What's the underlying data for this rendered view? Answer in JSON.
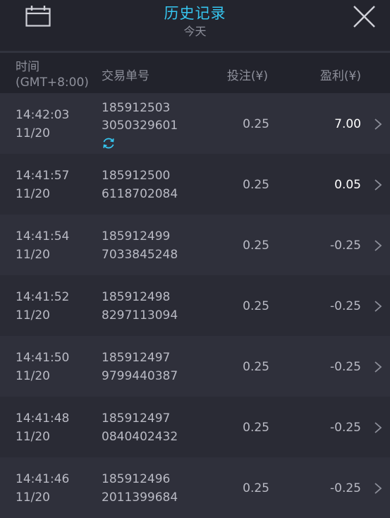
{
  "header": {
    "title": "历史记录",
    "subtitle": "今天",
    "accent_color": "#36c6f0",
    "left_icon": "calendar-icon",
    "right_icon": "close-icon"
  },
  "columns": {
    "time_line1": "时间",
    "time_line2": "(GMT+8:00)",
    "order": "交易单号",
    "bet": "投注(¥)",
    "profit": "盈利(¥)"
  },
  "rows": [
    {
      "time": "14:42:03",
      "date": "11/20",
      "order_line1": "185912503",
      "order_line2": "3050329601",
      "bet": "0.25",
      "profit": "7.00",
      "pending": true
    },
    {
      "time": "14:41:57",
      "date": "11/20",
      "order_line1": "185912500",
      "order_line2": "6118702084",
      "bet": "0.25",
      "profit": "0.05"
    },
    {
      "time": "14:41:54",
      "date": "11/20",
      "order_line1": "185912499",
      "order_line2": "7033845248",
      "bet": "0.25",
      "profit": "-0.25"
    },
    {
      "time": "14:41:52",
      "date": "11/20",
      "order_line1": "185912498",
      "order_line2": "8297113094",
      "bet": "0.25",
      "profit": "-0.25"
    },
    {
      "time": "14:41:50",
      "date": "11/20",
      "order_line1": "185912497",
      "order_line2": "9799440387",
      "bet": "0.25",
      "profit": "-0.25"
    },
    {
      "time": "14:41:48",
      "date": "11/20",
      "order_line1": "185912497",
      "order_line2": "0840402432",
      "bet": "0.25",
      "profit": "-0.25"
    },
    {
      "time": "14:41:46",
      "date": "11/20",
      "order_line1": "185912496",
      "order_line2": "2011399684",
      "bet": "0.25",
      "profit": "-0.25"
    }
  ]
}
